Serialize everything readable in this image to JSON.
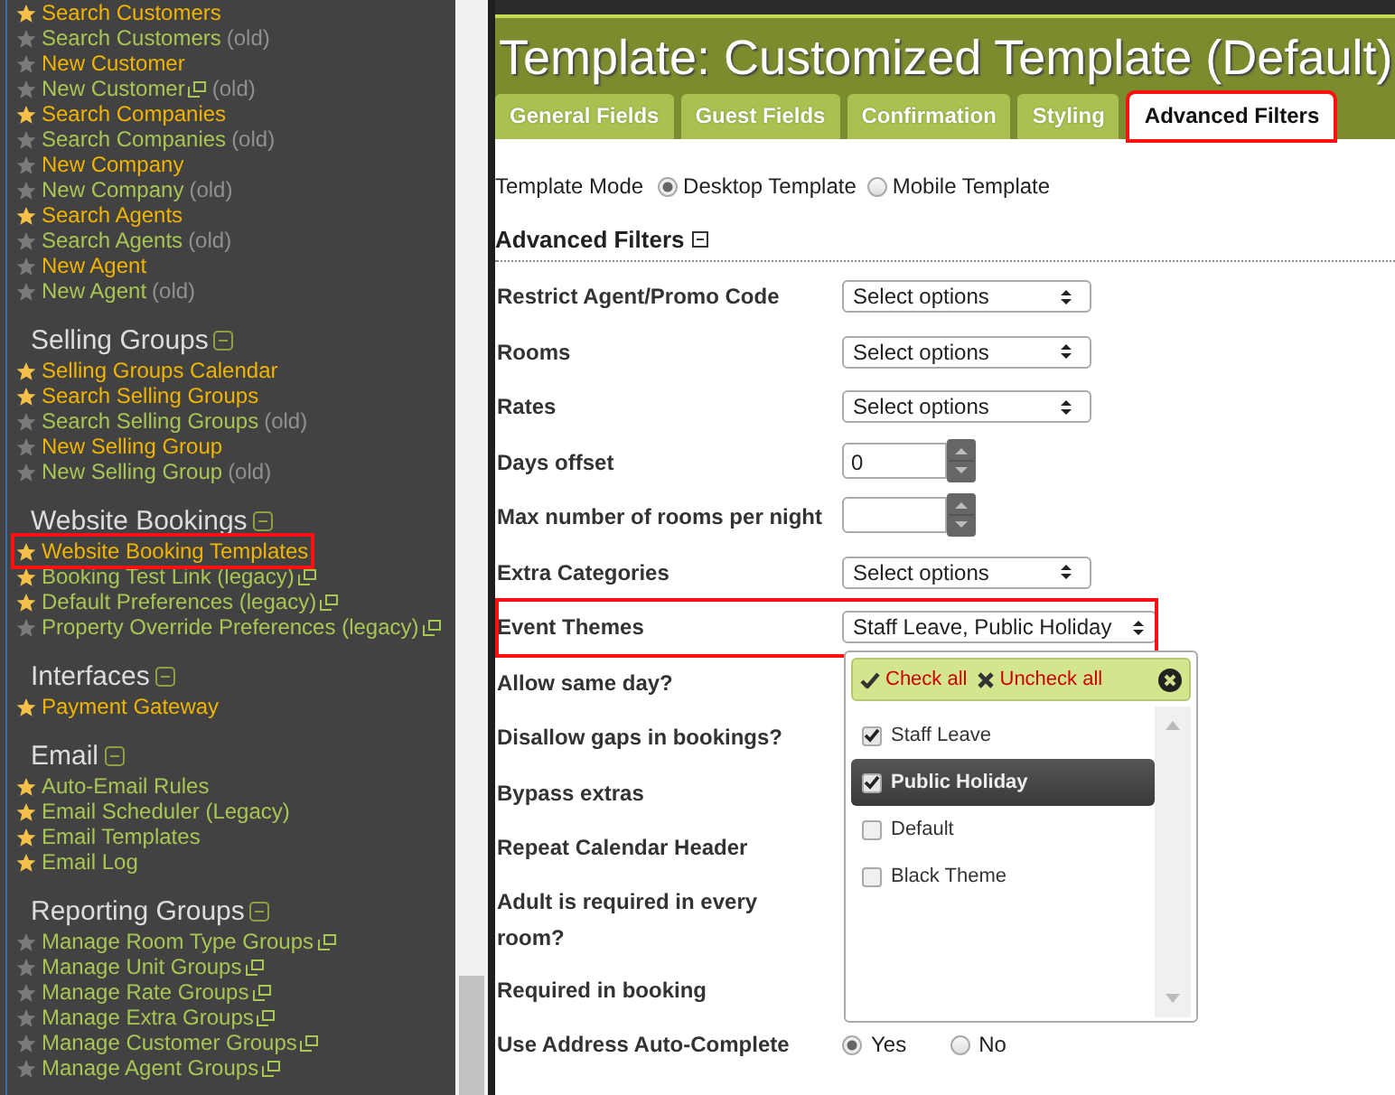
{
  "sidebar": {
    "sections": [
      {
        "items": [
          {
            "label": "Search Customers",
            "starred": true,
            "color": "#f0b400"
          },
          {
            "label": "Search Customers",
            "starred": false,
            "color": "#a9c553",
            "note": "(old)"
          },
          {
            "label": "New Customer",
            "starred": false,
            "color": "#f0b400"
          },
          {
            "label": "New Customer",
            "starred": false,
            "color": "#a9c553",
            "external": true,
            "note": "(old)"
          },
          {
            "label": "Search Companies",
            "starred": true,
            "color": "#f0b400"
          },
          {
            "label": "Search Companies",
            "starred": false,
            "color": "#a9c553",
            "note": "(old)"
          },
          {
            "label": "New Company",
            "starred": false,
            "color": "#f0b400"
          },
          {
            "label": "New Company",
            "starred": false,
            "color": "#a9c553",
            "note": "(old)"
          },
          {
            "label": "Search Agents",
            "starred": true,
            "color": "#f0b400"
          },
          {
            "label": "Search Agents",
            "starred": false,
            "color": "#a9c553",
            "note": "(old)"
          },
          {
            "label": "New Agent",
            "starred": false,
            "color": "#f0b400"
          },
          {
            "label": "New Agent",
            "starred": false,
            "color": "#a9c553",
            "note": "(old)"
          }
        ]
      },
      {
        "heading": "Selling Groups",
        "items": [
          {
            "label": "Selling Groups Calendar",
            "starred": true,
            "color": "#f0b400"
          },
          {
            "label": "Search Selling Groups",
            "starred": true,
            "color": "#f0b400"
          },
          {
            "label": "Search Selling Groups",
            "starred": false,
            "color": "#a9c553",
            "note": "(old)"
          },
          {
            "label": "New Selling Group",
            "starred": false,
            "color": "#f0b400"
          },
          {
            "label": "New Selling Group",
            "starred": false,
            "color": "#a9c553",
            "note": "(old)"
          }
        ]
      },
      {
        "heading": "Website Bookings",
        "items": [
          {
            "label": "Website Booking Templates",
            "starred": true,
            "color": "#f0b400",
            "highlighted": true
          },
          {
            "label": "Booking Test Link (legacy)",
            "starred": true,
            "color": "#a9c553",
            "external": true
          },
          {
            "label": "Default Preferences (legacy)",
            "starred": true,
            "color": "#a9c553",
            "external": true
          },
          {
            "label": "Property Override Preferences (legacy)",
            "starred": false,
            "color": "#a9c553",
            "external": true
          }
        ]
      },
      {
        "heading": "Interfaces",
        "items": [
          {
            "label": "Payment Gateway",
            "starred": true,
            "color": "#f0b400"
          }
        ]
      },
      {
        "heading": "Email",
        "items": [
          {
            "label": "Auto-Email Rules",
            "starred": true,
            "color": "#a9c553"
          },
          {
            "label": "Email Scheduler (Legacy)",
            "starred": true,
            "color": "#a9c553"
          },
          {
            "label": "Email Templates",
            "starred": true,
            "color": "#a9c553"
          },
          {
            "label": "Email Log",
            "starred": true,
            "color": "#a9c553"
          }
        ]
      },
      {
        "heading": "Reporting Groups",
        "items": [
          {
            "label": "Manage Room Type Groups",
            "starred": false,
            "color": "#a9c553",
            "external": true
          },
          {
            "label": "Manage Unit Groups",
            "starred": false,
            "color": "#a9c553",
            "external": true
          },
          {
            "label": "Manage Rate Groups",
            "starred": false,
            "color": "#a9c553",
            "external": true
          },
          {
            "label": "Manage Extra Groups",
            "starred": false,
            "color": "#a9c553",
            "external": true
          },
          {
            "label": "Manage Customer Groups",
            "starred": false,
            "color": "#a9c553",
            "external": true
          },
          {
            "label": "Manage Agent Groups",
            "starred": false,
            "color": "#a9c553",
            "external": true
          }
        ]
      }
    ]
  },
  "page_title": "Template: Customized Template (Default)",
  "tabs": [
    {
      "label": "General Fields",
      "selected": false,
      "highlighted": false
    },
    {
      "label": "Guest Fields",
      "selected": false,
      "highlighted": false
    },
    {
      "label": "Confirmation",
      "selected": false,
      "highlighted": false
    },
    {
      "label": "Styling",
      "selected": false,
      "highlighted": false
    },
    {
      "label": "Advanced Filters",
      "selected": true,
      "highlighted": true
    }
  ],
  "template_mode": {
    "label": "Template Mode",
    "options": [
      {
        "label": "Desktop Template",
        "selected": true
      },
      {
        "label": "Mobile Template",
        "selected": false
      }
    ]
  },
  "section_heading": "Advanced Filters",
  "fields": [
    {
      "label": "Restrict Agent/Promo Code",
      "kind": "select",
      "value": "Select options"
    },
    {
      "label": "Rooms",
      "kind": "select",
      "value": "Select options"
    },
    {
      "label": "Rates",
      "kind": "select",
      "value": "Select options"
    },
    {
      "label": "Days offset",
      "kind": "spinner",
      "value": "0"
    },
    {
      "label": "Max number of rooms per night",
      "kind": "spinner"
    },
    {
      "label": "Extra Categories",
      "kind": "select",
      "value": "Select options"
    },
    {
      "label": "Event Themes",
      "kind": "select",
      "value": "Staff Leave, Public Holiday",
      "highlighted": true,
      "wide": true
    },
    {
      "label": "Allow same day?",
      "kind": "hidden"
    },
    {
      "label": "Disallow gaps in bookings?",
      "kind": "hidden"
    },
    {
      "label": "Bypass extras",
      "kind": "hidden"
    },
    {
      "label": "Repeat Calendar Header",
      "kind": "hidden"
    },
    {
      "label": "Adult is required in every room?",
      "kind": "hidden"
    },
    {
      "label": "Required in booking",
      "kind": "hidden"
    },
    {
      "label": "Use Address Auto-Complete",
      "kind": "radio",
      "options": [
        {
          "label": "Yes",
          "selected": true
        },
        {
          "label": "No",
          "selected": false
        }
      ]
    }
  ],
  "dropdown": {
    "check_all": "Check all",
    "uncheck_all": "Uncheck all",
    "options": [
      {
        "label": "Staff Leave",
        "checked": true,
        "selected": false
      },
      {
        "label": "Public Holiday",
        "checked": true,
        "selected": true
      },
      {
        "label": "Default",
        "checked": false,
        "selected": false
      },
      {
        "label": "Black Theme",
        "checked": false,
        "selected": false
      }
    ]
  }
}
